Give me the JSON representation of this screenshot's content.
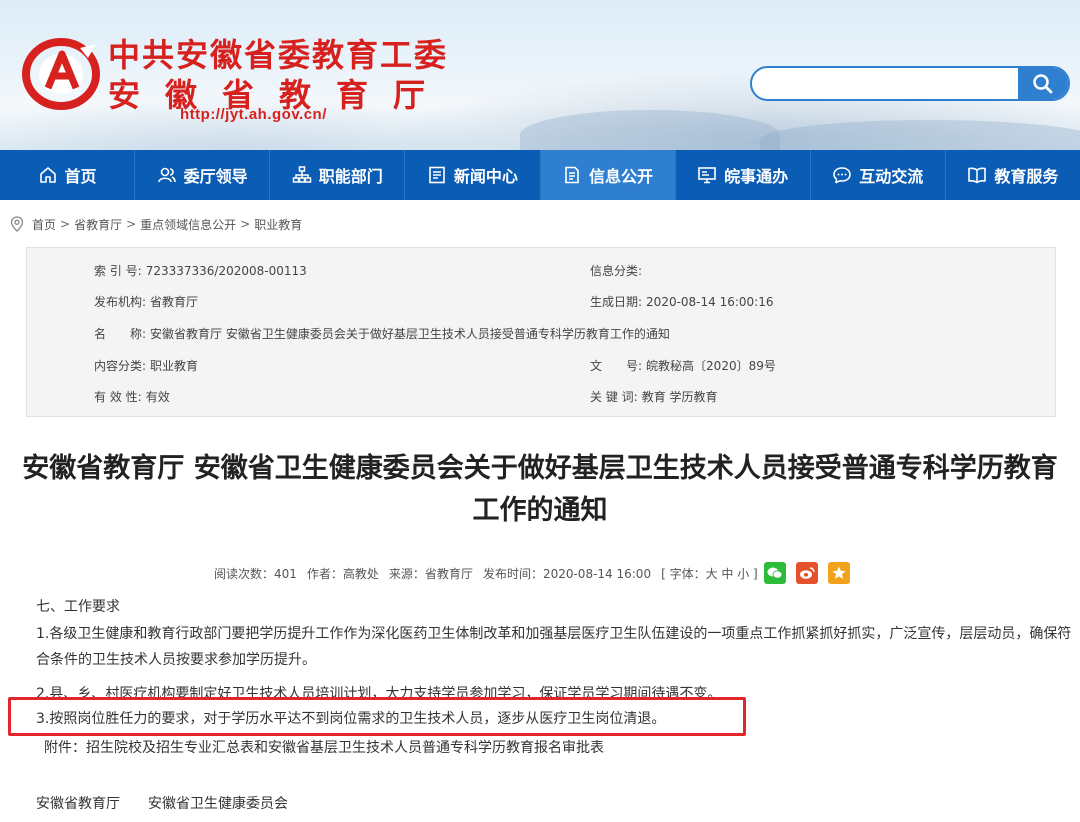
{
  "header": {
    "title_line1": "中共安徽省委教育工委",
    "title_line2": "安徽省教育厅",
    "url": "http://jyt.ah.gov.cn/",
    "search_placeholder": "",
    "brand_color": "#d7211e"
  },
  "nav": {
    "items": [
      {
        "label": "首页",
        "icon": "home-icon"
      },
      {
        "label": "委厅领导",
        "icon": "people-icon"
      },
      {
        "label": "职能部门",
        "icon": "org-chart-icon"
      },
      {
        "label": "新闻中心",
        "icon": "news-icon"
      },
      {
        "label": "信息公开",
        "icon": "document-icon",
        "active": true
      },
      {
        "label": "皖事通办",
        "icon": "monitor-icon"
      },
      {
        "label": "互动交流",
        "icon": "chat-icon"
      },
      {
        "label": "教育服务",
        "icon": "book-icon"
      }
    ],
    "bg_color": "#0b5cb5",
    "active_color": "#2f7fd0"
  },
  "breadcrumb": {
    "items": [
      "首页",
      "省教育厅",
      "重点领域信息公开",
      "职业教育"
    ],
    "separator": ">"
  },
  "meta": {
    "index_label": "索 引 号:",
    "index_value": "723337336/202008-00113",
    "category_label": "信息分类:",
    "category_value": "",
    "publisher_label": "发布机构:",
    "publisher_value": "省教育厅",
    "created_label": "生成日期:",
    "created_value": "2020-08-14 16:00:16",
    "name_label": "名　　称:",
    "name_value": "安徽省教育厅 安徽省卫生健康委员会关于做好基层卫生技术人员接受普通专科学历教育工作的通知",
    "content_label": "内容分类:",
    "content_value": "职业教育",
    "doc_label": "文　　号:",
    "doc_value": "皖教秘高〔2020〕89号",
    "valid_label": "有 效 性:",
    "valid_value": "有效",
    "keyword_label": "关 键 词:",
    "keyword_value": "教育 学历教育"
  },
  "article": {
    "title": "安徽省教育厅 安徽省卫生健康委员会关于做好基层卫生技术人员接受普通专科学历教育工作的通知",
    "reads": "阅读次数：401",
    "author": "作者：高教处",
    "source": "来源：省教育厅",
    "published": "发布时间：2020-08-14 16:00",
    "font_size_ctrl": "[ 字体：大 中 小 ]",
    "section_heading": "七、工作要求",
    "item1": "1.各级卫生健康和教育行政部门要把学历提升工作作为深化医药卫生体制改革和加强基层医疗卫生队伍建设的一项重点工作抓紧抓好抓实，广泛宣传，层层动员，确保符合条件的卫生技术人员按要求参加学历提升。",
    "item2": "2.县、乡、村医疗机构要制定好卫生技术人员培训计划，大力支持学员参加学习，保证学员学习期间待遇不变。",
    "item3": "3.按照岗位胜任力的要求，对于学历水平达不到岗位需求的卫生技术人员，逐步从医疗卫生岗位清退。",
    "attachment": "附件：招生院校及招生专业汇总表和安徽省基层卫生技术人员普通专科学历教育报名审批表",
    "signatories": "安徽省教育厅　　安徽省卫生健康委员会",
    "highlight_color": "#e2262b"
  }
}
